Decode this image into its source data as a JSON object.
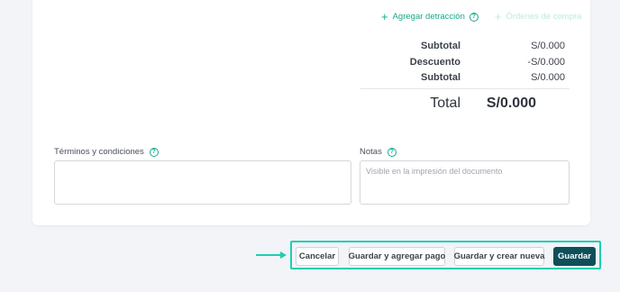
{
  "links": {
    "detraccion": "Agregar detracción",
    "ordenes": "Órdenes de compra"
  },
  "totals": {
    "rows": [
      {
        "label": "Subtotal",
        "value": "S/0.000"
      },
      {
        "label": "Descuento",
        "value": "-S/0.000"
      },
      {
        "label": "Subtotal",
        "value": "S/0.000"
      }
    ],
    "total_label": "Total",
    "total_value": "S/0.000"
  },
  "terms": {
    "label": "Términos y condiciones",
    "value": "",
    "placeholder": ""
  },
  "notes": {
    "label": "Notas",
    "value": "",
    "placeholder": "Visible en la impresión del documento"
  },
  "actions": {
    "cancel": "Cancelar",
    "save_add_payment": "Guardar y agregar pago",
    "save_create_new": "Guardar y crear nueva",
    "save": "Guardar"
  },
  "colors": {
    "accent": "#17a98a",
    "highlight": "#1ccfb0",
    "primary_button": "#0f4f5a",
    "background": "#f3f4f8"
  },
  "icons": {
    "add": "plus-icon",
    "help": "help-circle-icon",
    "pointer": "arrow-right-icon"
  }
}
